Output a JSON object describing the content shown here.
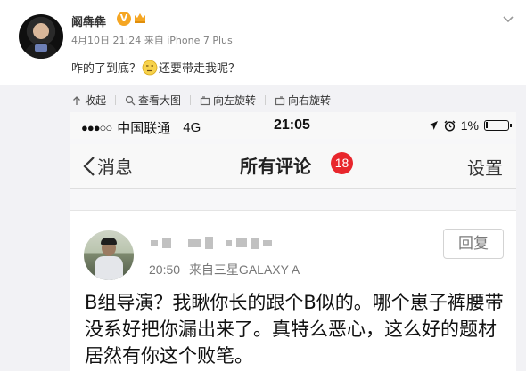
{
  "post": {
    "username": "阚犇犇",
    "verified_badge": "V",
    "timestamp": "4月10日 21:24",
    "source_prefix": "来自",
    "device": "iPhone 7 Plus",
    "text_before_emoji": "咋的了到底？",
    "emoji": "frown-emoji",
    "text_after_emoji": "还要带走我呢？"
  },
  "toolbar": {
    "collapse": "收起",
    "view_large": "查看大图",
    "rotate_left": "向左旋转",
    "rotate_right": "向右旋转"
  },
  "screenshot": {
    "status": {
      "signal": "●●●○○",
      "carrier": "中国联通",
      "network": "4G",
      "time": "21:05",
      "battery": "1%"
    },
    "nav": {
      "back_label": "消息",
      "title": "所有评论",
      "count": "18",
      "settings": "设置"
    },
    "comment": {
      "time": "20:50",
      "source": "来自三星GALAXY A",
      "reply_label": "回复",
      "text": "B组导演？我瞅你长的跟个B似的。哪个崽子裤腰带没系好把你漏出来了。真特么恶心，这么好的题材居然有你这个败笔。"
    }
  },
  "colors": {
    "badge_red": "#e8262c",
    "verified": "#f5a623",
    "toolbar_bg": "#f2f2f5"
  }
}
